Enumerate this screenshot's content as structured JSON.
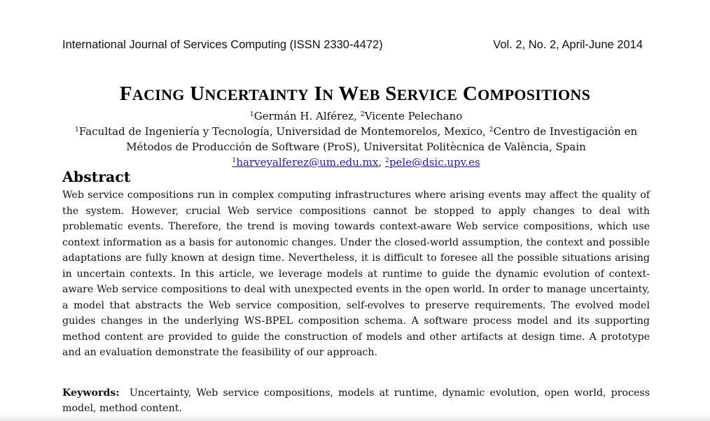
{
  "header": {
    "journal": "International Journal of Services Computing (ISSN 2330-4472)",
    "volume": "Vol. 2, No. 2, April-June 2014"
  },
  "title": {
    "w1_initial": "F",
    "w1_rest": "ACING",
    "w2_initial": "U",
    "w2_rest": "NCERTAINTY",
    "w3_initial": "I",
    "w3_rest": "N",
    "w4_initial": "W",
    "w4_rest": "EB",
    "w5_initial": "S",
    "w5_rest": "ERVICE",
    "w6_initial": "C",
    "w6_rest": "OMPOSITIONS"
  },
  "authors": {
    "a1_mark": "1",
    "a1_name": "Germán H. Alférez,",
    "a2_mark": "2",
    "a2_name": "Vicente Pelechano"
  },
  "affiliations": {
    "f1_mark": "1",
    "f1_text": "Facultad de Ingeniería y Tecnología, Universidad de Montemorelos, Mexico,",
    "f2_mark": "2",
    "f2_text_line1": "Centro de Investigación en",
    "f2_text_line2": "Métodos de Producción de Software (ProS), Universitat Politècnica de València, Spain"
  },
  "emails": {
    "e1_mark": "1",
    "e1": "harveyalferez@um.edu.mx",
    "separator": ",",
    "e2_mark": "2",
    "e2": "pele@dsic.upv.es"
  },
  "abstract": {
    "heading": "Abstract",
    "body": "Web service compositions run in complex computing infrastructures where arising events may affect the quality of the system. However, crucial Web service compositions cannot be stopped to apply changes to deal with problematic events. Therefore, the trend is moving towards context-aware Web service compositions, which use context information as a basis for autonomic changes. Under the closed-world assumption, the context and possible adaptations are fully known at design time. Nevertheless, it is difficult to foresee all the possible situations arising in uncertain contexts. In this article, we leverage models at runtime to guide the dynamic evolution of context-aware Web service compositions to deal with unexpected events in the open world. In order to manage uncertainty, a model that abstracts the Web service composition, self-evolves to preserve requirements. The evolved model guides changes in the underlying WS-BPEL composition schema. A software process model and its supporting method content are provided to guide the construction of models and other artifacts at design time. A prototype and an evaluation demonstrate the feasibility of our approach."
  },
  "keywords": {
    "label": "Keywords:",
    "text": "Uncertainty, Web service compositions, models at runtime, dynamic evolution, open world, process model, method content."
  }
}
